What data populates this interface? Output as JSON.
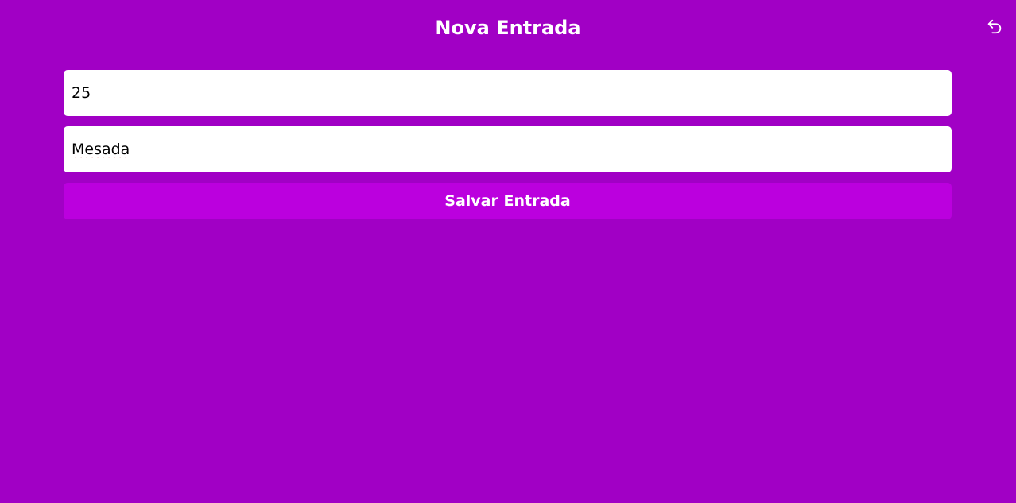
{
  "header": {
    "title": "Nova Entrada",
    "back_icon": "undo-arrow-icon"
  },
  "form": {
    "value_field": {
      "value": "25"
    },
    "description_field": {
      "value": "Mesada"
    },
    "submit_label": "Salvar Entrada"
  },
  "colors": {
    "background": "#a100c5",
    "button": "#bb00de",
    "text_light": "#ffffff"
  }
}
